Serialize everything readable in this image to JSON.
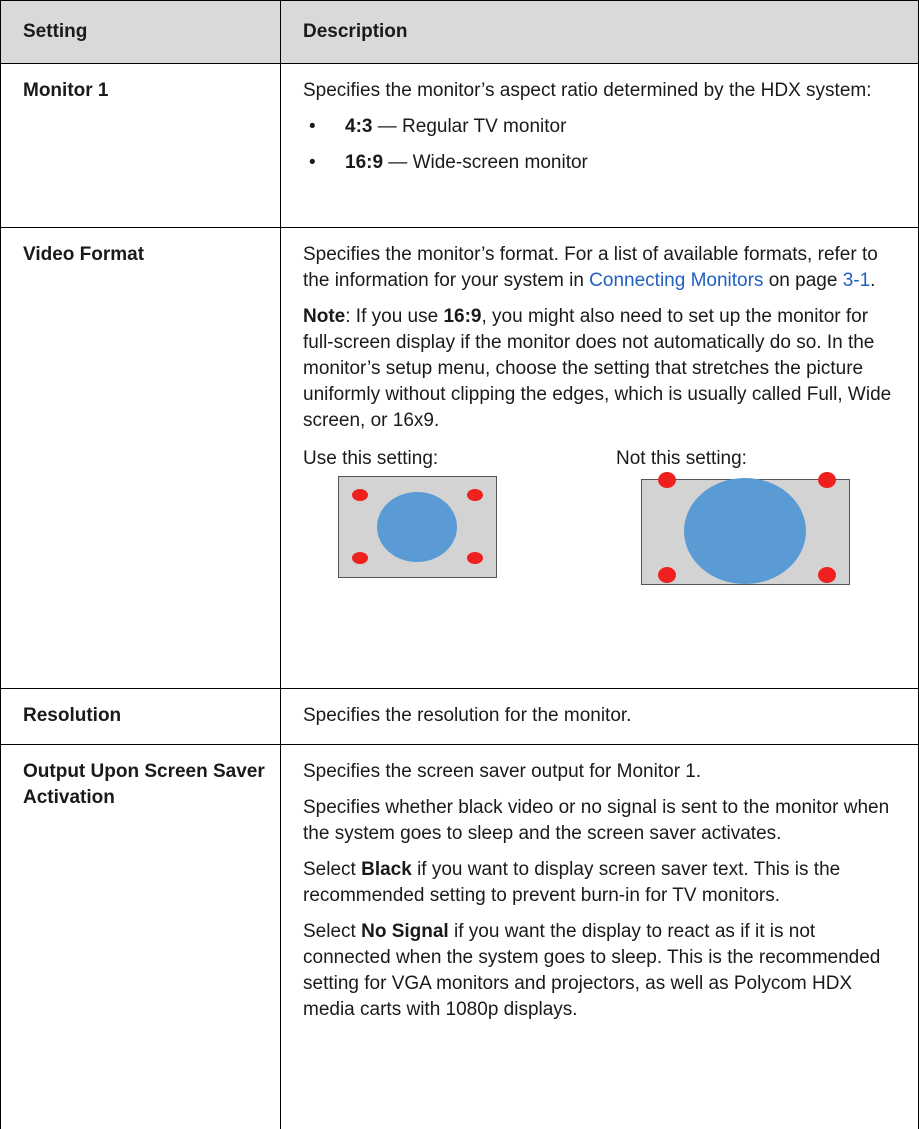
{
  "header": {
    "setting": "Setting",
    "description": "Description"
  },
  "monitor1": {
    "name": "Monitor 1",
    "intro": "Specifies the monitor’s aspect ratio determined by the HDX system:",
    "bullets": [
      {
        "bullet": "•",
        "term": "4:3",
        "text": " — Regular TV monitor"
      },
      {
        "bullet": "•",
        "term": "16:9",
        "text": " — Wide-screen monitor"
      }
    ]
  },
  "video_format": {
    "name": "Video Format",
    "p1_a": "Specifies the monitor’s format. For a list of available formats, refer to the information for your system in ",
    "p1_link": "Connecting Monitors",
    "p1_b": " on page ",
    "p1_page": "3-1",
    "p1_c": ".",
    "note_label": "Note",
    "note_a": ": If you use ",
    "note_term": "16:9",
    "note_b": ", you might also need to set up the monitor for full-screen display if the monitor does not automatically do so. In the monitor’s setup menu, choose the setting that stretches the picture uniformly without clipping the edges, which is usually called Full, Wide screen, or 16x9.",
    "fig_use": "Use this setting:",
    "fig_not": "Not this setting:",
    "colors": {
      "screen": "#d3d3d3",
      "circle": "#5b9bd5",
      "dot": "#ee2020"
    }
  },
  "resolution": {
    "name": "Resolution",
    "text": "Specifies the resolution for the monitor."
  },
  "screen_saver": {
    "name": "Output Upon Screen Saver Activation",
    "p1": "Specifies the screen saver output for Monitor 1.",
    "p2": "Specifies whether black video or no signal is sent to the monitor when the system goes to sleep and the screen saver activates.",
    "p3_a": "Select ",
    "p3_term": "Black",
    "p3_b": " if you want to display screen saver text. This is the recommended setting to prevent burn-in for TV monitors.",
    "p4_a": "Select ",
    "p4_term": "No Signal",
    "p4_b": " if you want the display to react as if it is not connected when the system goes to sleep. This is the recommended setting for VGA monitors and projectors, as well as Polycom HDX media carts with 1080p displays."
  }
}
